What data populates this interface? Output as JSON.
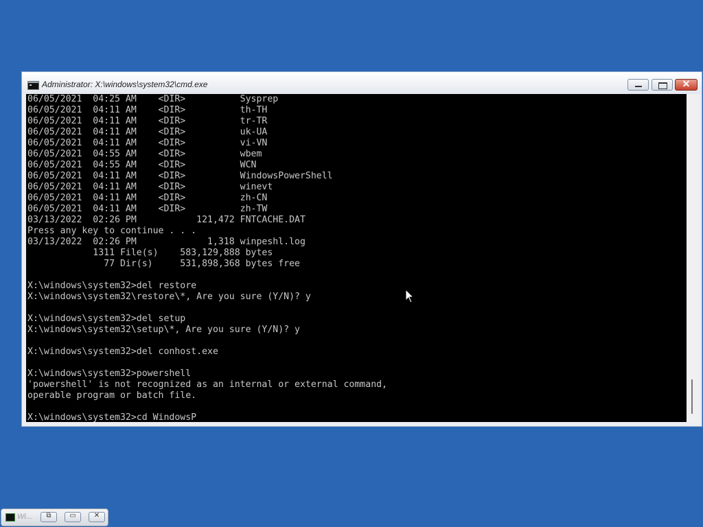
{
  "window": {
    "title": "Administrator: X:\\windows\\system32\\cmd.exe",
    "buttons": {
      "minimize": "",
      "maximize": "",
      "close": "✕"
    }
  },
  "console": {
    "lines": [
      "06/05/2021  04:25 AM    <DIR>          Sysprep",
      "06/05/2021  04:11 AM    <DIR>          th-TH",
      "06/05/2021  04:11 AM    <DIR>          tr-TR",
      "06/05/2021  04:11 AM    <DIR>          uk-UA",
      "06/05/2021  04:11 AM    <DIR>          vi-VN",
      "06/05/2021  04:55 AM    <DIR>          wbem",
      "06/05/2021  04:55 AM    <DIR>          WCN",
      "06/05/2021  04:11 AM    <DIR>          WindowsPowerShell",
      "06/05/2021  04:11 AM    <DIR>          winevt",
      "06/05/2021  04:11 AM    <DIR>          zh-CN",
      "06/05/2021  04:11 AM    <DIR>          zh-TW",
      "03/13/2022  02:26 PM           121,472 FNTCACHE.DAT",
      "Press any key to continue . . .",
      "03/13/2022  02:26 PM             1,318 winpeshl.log",
      "            1311 File(s)    583,129,888 bytes",
      "              77 Dir(s)     531,898,368 bytes free",
      "",
      "X:\\windows\\system32>del restore",
      "X:\\windows\\system32\\restore\\*, Are you sure (Y/N)? y",
      "",
      "X:\\windows\\system32>del setup",
      "X:\\windows\\system32\\setup\\*, Are you sure (Y/N)? y",
      "",
      "X:\\windows\\system32>del conhost.exe",
      "",
      "X:\\windows\\system32>powershell",
      "'powershell' is not recognized as an internal or external command,",
      "operable program or batch file.",
      "",
      "X:\\windows\\system32>cd WindowsP"
    ]
  },
  "taskbar": {
    "minimized_title": "Wi...",
    "buttons": {
      "restore": "⧉",
      "maximize": "▭",
      "close": "✕"
    }
  },
  "icons": {
    "app": "cmd-icon",
    "cursor": "mouse-pointer-icon"
  },
  "colors": {
    "desktop": "#2a66b4",
    "console_bg": "#000000",
    "console_text": "#c8c8c8",
    "close_button": "#c8402c"
  }
}
